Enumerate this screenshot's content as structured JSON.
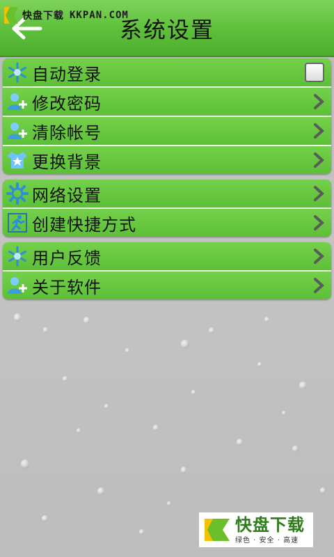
{
  "watermark": {
    "name": "快盘下载",
    "url": "KKPAN.COM"
  },
  "header": {
    "title": "系统设置"
  },
  "groups": [
    {
      "items": [
        {
          "label": "自动登录",
          "icon": "snowflake-icon",
          "control": "checkbox",
          "checked": false
        },
        {
          "label": "修改密码",
          "icon": "user-add-icon",
          "control": "chevron"
        },
        {
          "label": "清除帐号",
          "icon": "user-add-icon",
          "control": "chevron"
        },
        {
          "label": "更换背景",
          "icon": "star-shirt-icon",
          "control": "chevron"
        }
      ]
    },
    {
      "items": [
        {
          "label": "网络设置",
          "icon": "gear-icon",
          "control": "chevron"
        },
        {
          "label": "创建快捷方式",
          "icon": "run-icon",
          "control": "chevron"
        }
      ]
    },
    {
      "items": [
        {
          "label": "用户反馈",
          "icon": "snowflake-icon",
          "control": "chevron"
        },
        {
          "label": "关于软件",
          "icon": "user-add-icon",
          "control": "chevron"
        }
      ]
    }
  ],
  "brand": {
    "main": "快盘下载",
    "tagline": "绿色 · 安全 · 高速"
  },
  "colors": {
    "accent": "#5cbf3a",
    "header_dark": "#3f8f25",
    "row_separator": "#e9f7e2"
  }
}
